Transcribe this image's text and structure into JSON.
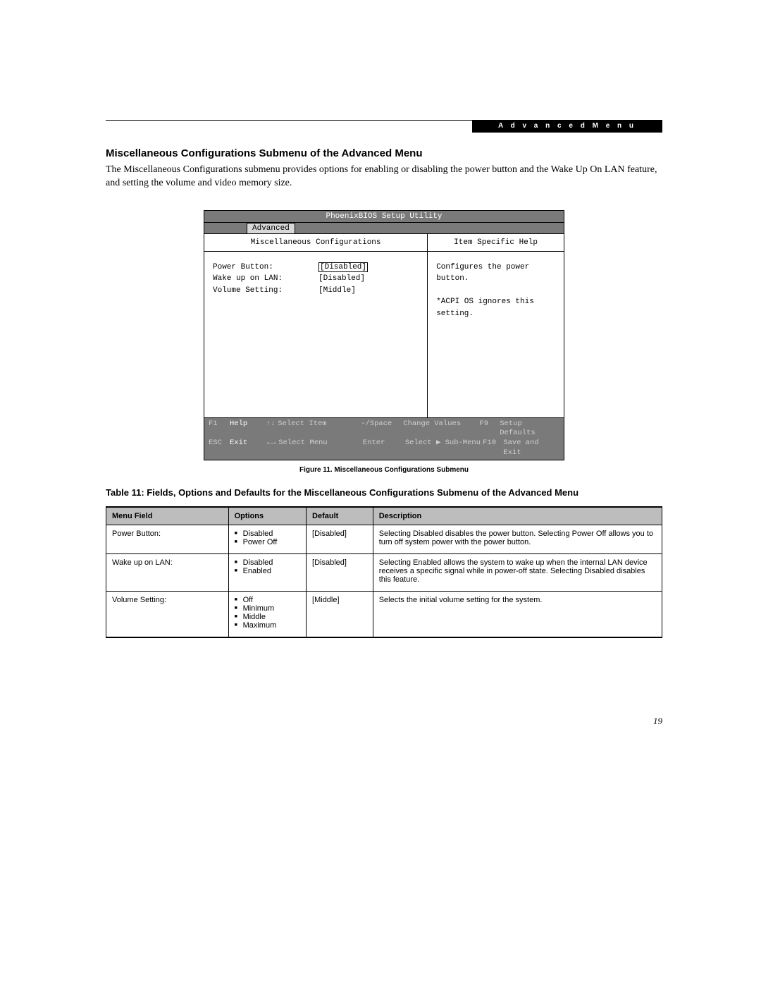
{
  "header": {
    "tag": "A d v a n c e d   M e n u"
  },
  "section": {
    "title": "Miscellaneous Configurations Submenu of the Advanced Menu",
    "intro": "The Miscellaneous Configurations submenu provides options for enabling or disabling the power button and the Wake Up On LAN feature, and setting the volume and video memory size."
  },
  "bios": {
    "utility_title": "PhoenixBIOS Setup Utility",
    "active_tab": "Advanced",
    "left_title": "Miscellaneous Configurations",
    "right_title": "Item Specific Help",
    "settings": [
      {
        "label": "Power Button:",
        "value": "[Disabled]",
        "selected": true
      },
      {
        "label": "Wake up on LAN:",
        "value": "[Disabled]",
        "selected": false
      },
      {
        "label": "Volume Setting:",
        "value": "[Middle]",
        "selected": false
      }
    ],
    "help_lines": [
      "Configures the power",
      "button.",
      "",
      "*ACPI OS ignores this",
      "setting."
    ],
    "footer": {
      "row1": {
        "k1": "F1",
        "l1": "Help",
        "a2": "↑↓",
        "t2": "Select Item",
        "k3": "-/Space",
        "t3": "Change Values",
        "k4": "F9",
        "t4": "Setup Defaults"
      },
      "row2": {
        "k1": "ESC",
        "l1": "Exit",
        "a2": "←→",
        "t2": "Select Menu",
        "k3": "Enter",
        "t3": "Select ▶ Sub-Menu",
        "k4": "F10",
        "t4": "Save and Exit"
      }
    }
  },
  "figure_caption": "Figure 11.  Miscellaneous Configurations Submenu",
  "table_title": "Table 11: Fields, Options and Defaults for the Miscellaneous Configurations Submenu of the Advanced Menu",
  "table": {
    "headers": {
      "field": "Menu Field",
      "options": "Options",
      "def": "Default",
      "desc": "Description"
    },
    "rows": [
      {
        "field": "Power Button:",
        "options": [
          "Disabled",
          "Power Off"
        ],
        "def": "[Disabled]",
        "desc": "Selecting Disabled disables the power button. Selecting Power Off allows you to turn off system power with the power button."
      },
      {
        "field": "Wake up on LAN:",
        "options": [
          "Disabled",
          "Enabled"
        ],
        "def": "[Disabled]",
        "desc": "Selecting Enabled allows the system to wake up when the internal LAN device receives a specific signal while in power-off state. Selecting Disabled disables this feature."
      },
      {
        "field": "Volume Setting:",
        "options": [
          "Off",
          "Minimum",
          "Middle",
          "Maximum"
        ],
        "def": "[Middle]",
        "desc": "Selects the initial volume setting for the system."
      }
    ]
  },
  "page_number": "19"
}
